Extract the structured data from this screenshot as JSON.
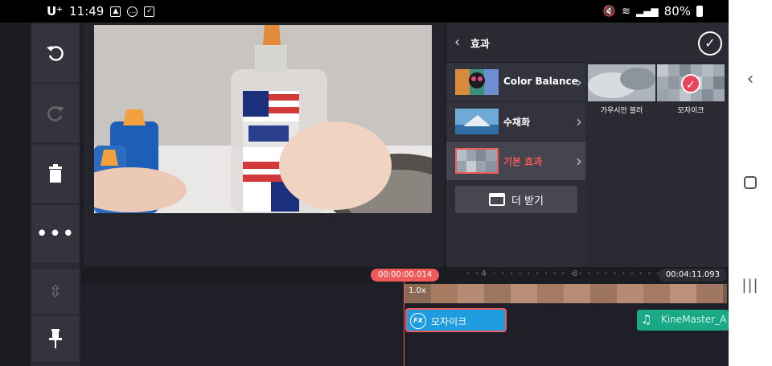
{
  "status_bar": {
    "carrier": "U⁺",
    "time": "11:49",
    "battery": "80%"
  },
  "preview": {
    "image_description_icon": "video-preview"
  },
  "panel": {
    "title": "효과",
    "categories": [
      {
        "label": "Color Balance"
      },
      {
        "label": "수채화"
      },
      {
        "label": "기본 효과"
      }
    ],
    "more_label": "더 받기",
    "effects": [
      {
        "label": "가우시안 블러"
      },
      {
        "label": "모자이크"
      }
    ]
  },
  "timeline": {
    "current_time": "00:00:00.014",
    "total_time": "00:04:11.093",
    "ruler_ticks": [
      "4",
      "8"
    ],
    "speed": "1.0x",
    "fx_clip_label": "모자이크",
    "audio_clip_label": "KineMaster_A"
  },
  "colors": {
    "accent": "#f05a5a",
    "fx_clip": "#1f9be0",
    "audio_clip": "#1aa886"
  }
}
